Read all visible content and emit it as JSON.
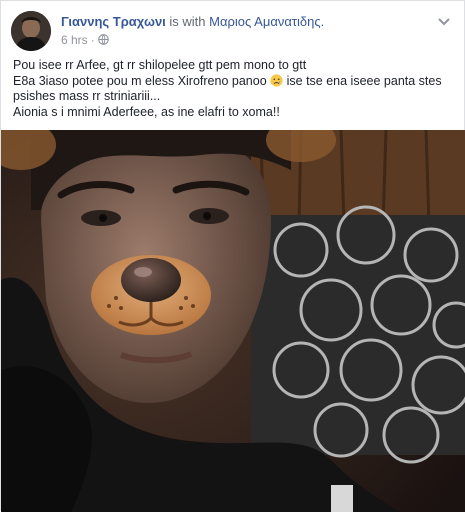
{
  "post": {
    "author": "Γιαννης Τραχωνι",
    "with_text": "is with",
    "tagged": "Μαριος Αμανατιδης.",
    "time": "6 hrs",
    "privacy_icon": "globe-icon",
    "menu_icon": "chevron-down-icon",
    "lines": [
      "Pou isee rr Arfee, gt rr shilopelee gtt pem mono to gtt",
      "Ε8a 3iaso potee pou m eless Xirofreno panoo",
      "ise tse ena iseee panta stes",
      "psishes mass rr striniariii...",
      "Aionia s i mnimi Aderfeee, as ine elafri to xoma!!"
    ],
    "emoji_icon": "sad-face-emoji-icon"
  },
  "colors": {
    "link": "#365899",
    "meta": "#90949c",
    "text": "#1d2129"
  }
}
